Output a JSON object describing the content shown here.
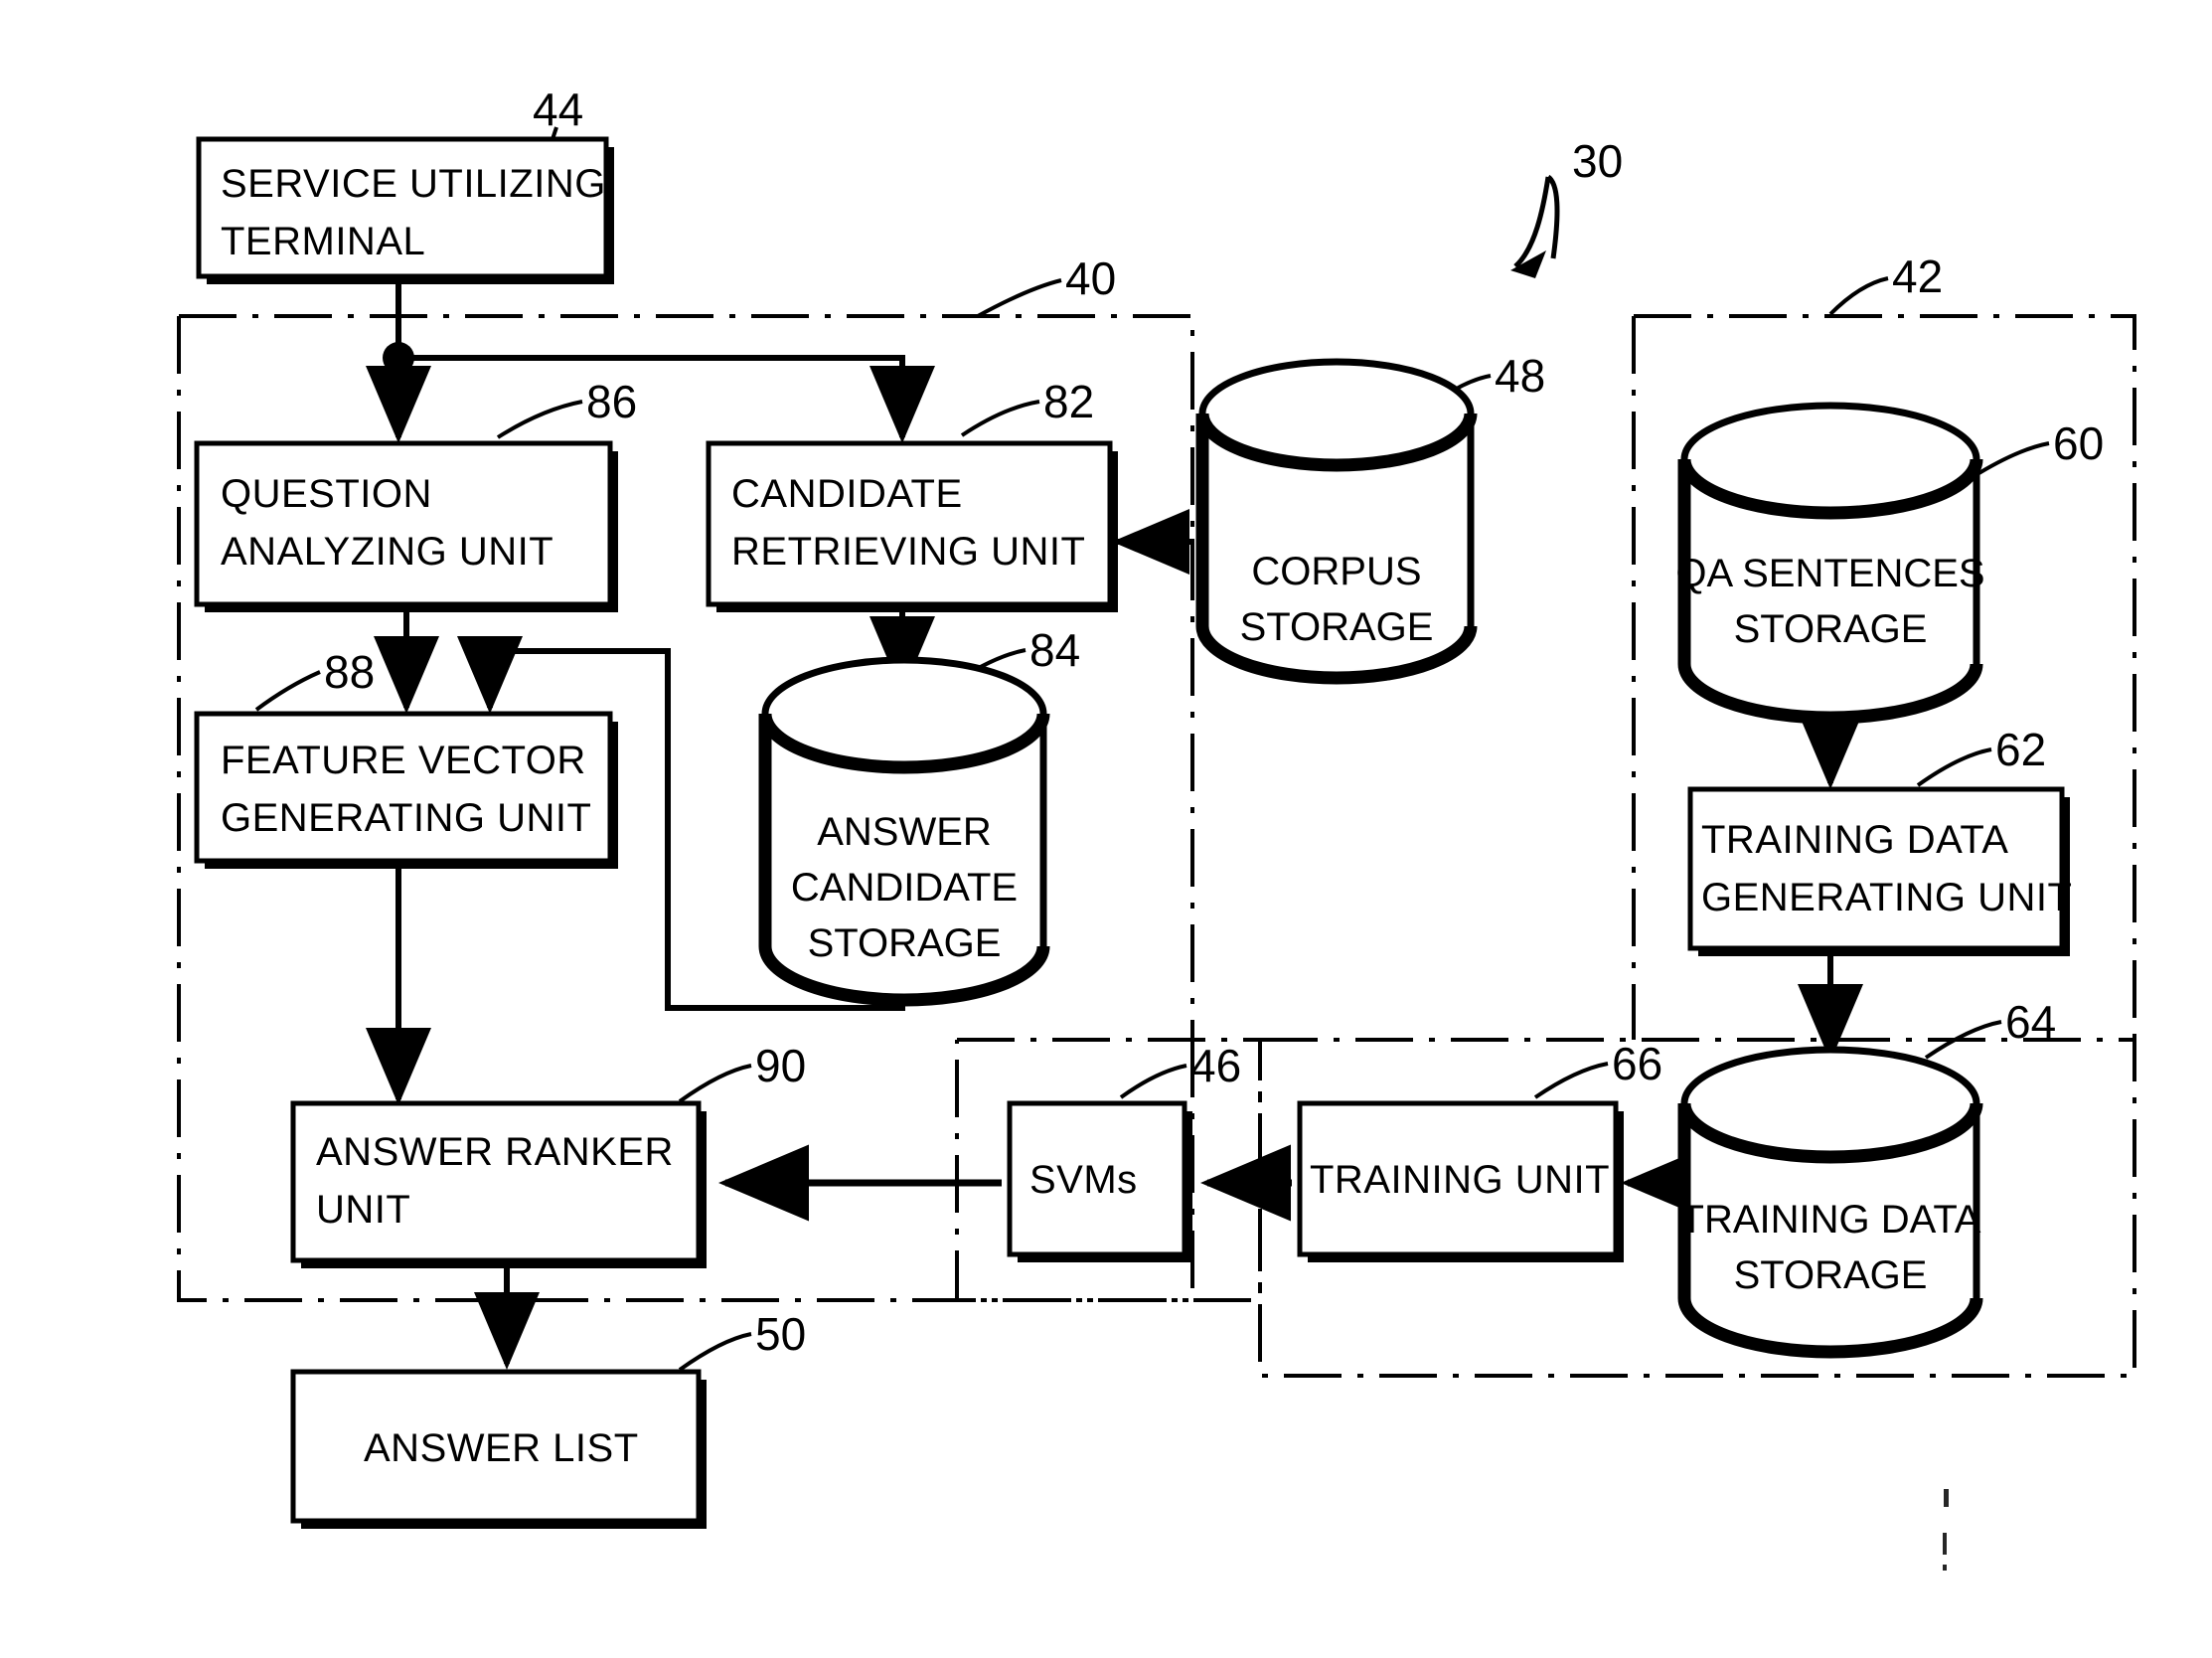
{
  "figure": {
    "type": "patent-block-diagram",
    "system_reference": "30",
    "background_color": "#ffffff",
    "line_color": "#000000"
  },
  "blocks": [
    {
      "id": "service-utilizing-terminal",
      "ref": "44",
      "lines": [
        "SERVICE UTILIZING",
        "TERMINAL"
      ],
      "shape": "rect"
    },
    {
      "id": "question-analyzing-unit",
      "ref": "86",
      "lines": [
        "QUESTION",
        "ANALYZING UNIT"
      ],
      "shape": "rect"
    },
    {
      "id": "candidate-retrieving-unit",
      "ref": "82",
      "lines": [
        "CANDIDATE",
        "RETRIEVING UNIT"
      ],
      "shape": "rect"
    },
    {
      "id": "feature-vector-generating-unit",
      "ref": "88",
      "lines": [
        "FEATURE VECTOR",
        "GENERATING UNIT"
      ],
      "shape": "rect"
    },
    {
      "id": "answer-ranker-unit",
      "ref": "90",
      "lines": [
        "ANSWER RANKER",
        "UNIT"
      ],
      "shape": "rect"
    },
    {
      "id": "answer-list",
      "ref": "50",
      "lines": [
        "ANSWER LIST"
      ],
      "shape": "rect"
    },
    {
      "id": "svms",
      "ref": "46",
      "lines": [
        "SVMs"
      ],
      "shape": "rect"
    },
    {
      "id": "training-unit",
      "ref": "66",
      "lines": [
        "TRAINING UNIT"
      ],
      "shape": "rect"
    },
    {
      "id": "training-data-generating-unit",
      "ref": "62",
      "lines": [
        "TRAINING DATA",
        "GENERATING UNIT"
      ],
      "shape": "rect"
    },
    {
      "id": "answer-candidate-storage",
      "ref": "84",
      "lines": [
        "ANSWER",
        "CANDIDATE",
        "STORAGE"
      ],
      "shape": "cylinder"
    },
    {
      "id": "corpus-storage",
      "ref": "48",
      "lines": [
        "CORPUS",
        "STORAGE"
      ],
      "shape": "cylinder"
    },
    {
      "id": "qa-sentences-storage",
      "ref": "60",
      "lines": [
        "QA SENTENCES",
        "STORAGE"
      ],
      "shape": "cylinder"
    },
    {
      "id": "training-data-storage",
      "ref": "64",
      "lines": [
        "TRAINING DATA",
        "STORAGE"
      ],
      "shape": "cylinder"
    }
  ],
  "groups": [
    {
      "id": "answering-system-group",
      "ref": "40",
      "style": "dash-dot"
    },
    {
      "id": "training-system-group",
      "ref": "42",
      "style": "dash-dot"
    },
    {
      "id": "svm-group",
      "ref": "46-group",
      "style": "dash-dot"
    },
    {
      "id": "training-subsystem-group",
      "ref": "66-group",
      "style": "dash-dot"
    }
  ],
  "text": {
    "service_utilizing_terminal_l1": "SERVICE UTILIZING",
    "service_utilizing_terminal_l2": "TERMINAL",
    "question_analyzing_unit_l1": "QUESTION",
    "question_analyzing_unit_l2": "ANALYZING UNIT",
    "candidate_retrieving_unit_l1": "CANDIDATE",
    "candidate_retrieving_unit_l2": "RETRIEVING UNIT",
    "feature_vector_generating_unit_l1": "FEATURE VECTOR",
    "feature_vector_generating_unit_l2": "GENERATING UNIT",
    "answer_ranker_unit_l1": "ANSWER RANKER",
    "answer_ranker_unit_l2": "UNIT",
    "answer_list_l1": "ANSWER LIST",
    "svms_l1": "SVMs",
    "training_unit_l1": "TRAINING UNIT",
    "training_data_generating_unit_l1": "TRAINING DATA",
    "training_data_generating_unit_l2": "GENERATING UNIT",
    "answer_candidate_storage_l1": "ANSWER",
    "answer_candidate_storage_l2": "CANDIDATE",
    "answer_candidate_storage_l3": "STORAGE",
    "corpus_storage_l1": "CORPUS",
    "corpus_storage_l2": "STORAGE",
    "qa_sentences_storage_l1": "QA SENTENCES",
    "qa_sentences_storage_l2": "STORAGE",
    "training_data_storage_l1": "TRAINING DATA",
    "training_data_storage_l2": "STORAGE"
  },
  "refs": {
    "r30": "30",
    "r40": "40",
    "r42": "42",
    "r44": "44",
    "r46": "46",
    "r48": "48",
    "r50": "50",
    "r60": "60",
    "r62": "62",
    "r64": "64",
    "r66": "66",
    "r82": "82",
    "r84": "84",
    "r86": "86",
    "r88": "88",
    "r90": "90"
  }
}
